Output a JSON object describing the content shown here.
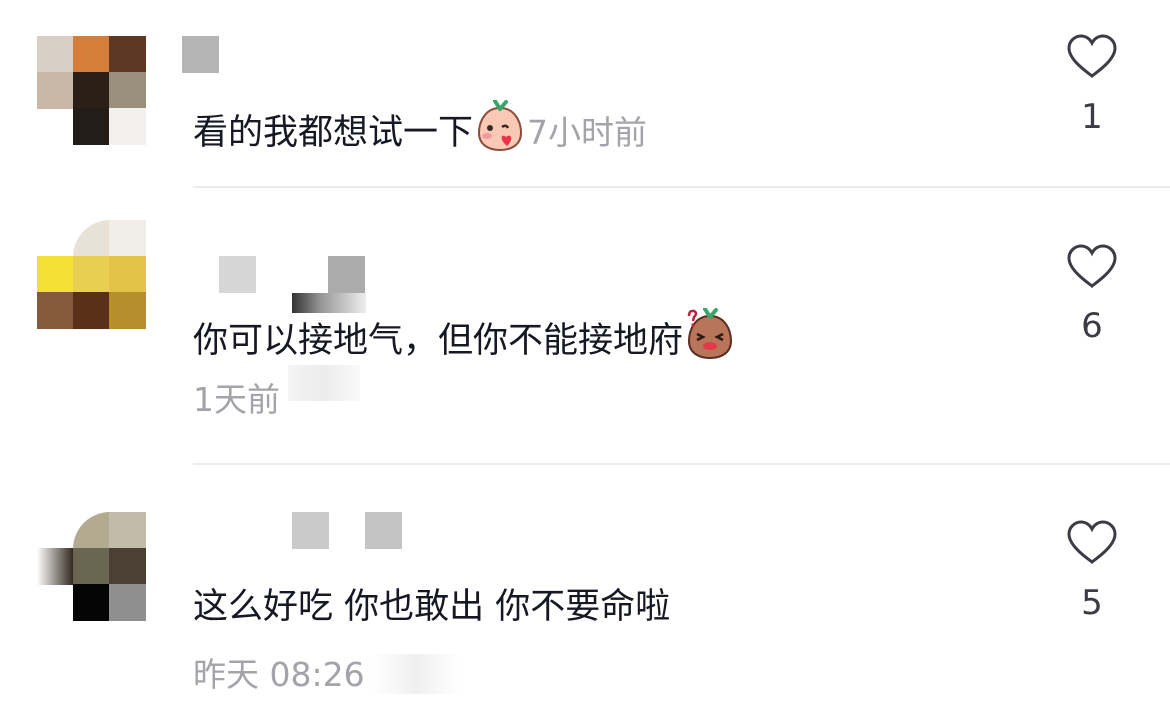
{
  "comments": [
    {
      "text": "看的我都想试一下",
      "emoji": "blushing-kiss-emoji",
      "time": "7小时前",
      "likes": "1",
      "avatar_colors": [
        "#d8cfc5",
        "#d57e3c",
        "#5d3822",
        "#c9b7a7",
        "#2a2018",
        "#9a8f7d",
        "#ffffff",
        "#231c17",
        "#f2f1ee"
      ]
    },
    {
      "text": "你可以接地气，但你不能接地府",
      "emoji": "blushing-shy-emoji",
      "time": "1天前",
      "likes": "6",
      "avatar_colors": [
        "#f4df33",
        "#e8cf53",
        "#e3c34a",
        "#87593b",
        "#5b3018",
        "#b58f2b"
      ]
    },
    {
      "text": "这么好吃 你也敢出 你不要命啦",
      "time": "昨天 08:26",
      "likes": "5",
      "avatar_colors": [
        "#b3ab91",
        "#c3bba9",
        "#2e231a",
        "#6b6650",
        "#4c3f33",
        "#050505",
        "#8f8f8f"
      ]
    }
  ]
}
